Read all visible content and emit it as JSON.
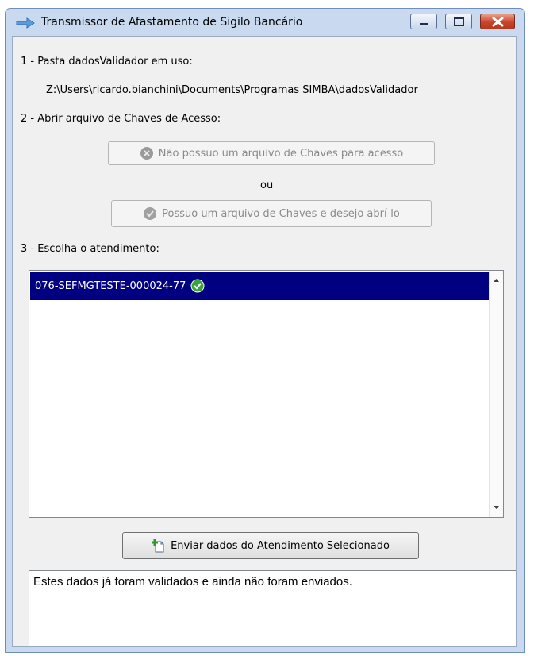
{
  "window": {
    "title": "Transmissor de Afastamento de Sigilo Bancário",
    "controls": [
      "minimize",
      "maximize",
      "close"
    ]
  },
  "step1": {
    "label": "1 - Pasta dadosValidador em uso:",
    "path": "Z:\\Users\\ricardo.bianchini\\Documents\\Programas SIMBA\\dadosValidador"
  },
  "step2": {
    "label": "2 - Abrir arquivo de Chaves de Acesso:",
    "no_key_button": "Não possuo um arquivo de Chaves para acesso",
    "or_text": "ou",
    "open_key_button": "Possuo um arquivo de Chaves e desejo abrí-lo"
  },
  "step3": {
    "label": "3 - Escolha o atendimento:",
    "items": [
      {
        "text": "076-SEFMGTESTE-000024-77",
        "selected": true,
        "status_icon": "check-circle-icon"
      }
    ]
  },
  "send_button": "Enviar dados do Atendimento Selecionado",
  "status_message": "Estes dados já foram validados e ainda não foram enviados.",
  "colors": {
    "selection": "#000080",
    "window_frame": "#c9daf0",
    "client_bg": "#f0f0f0",
    "check_green": "#3aa43a",
    "close_red": "#c9442a"
  }
}
